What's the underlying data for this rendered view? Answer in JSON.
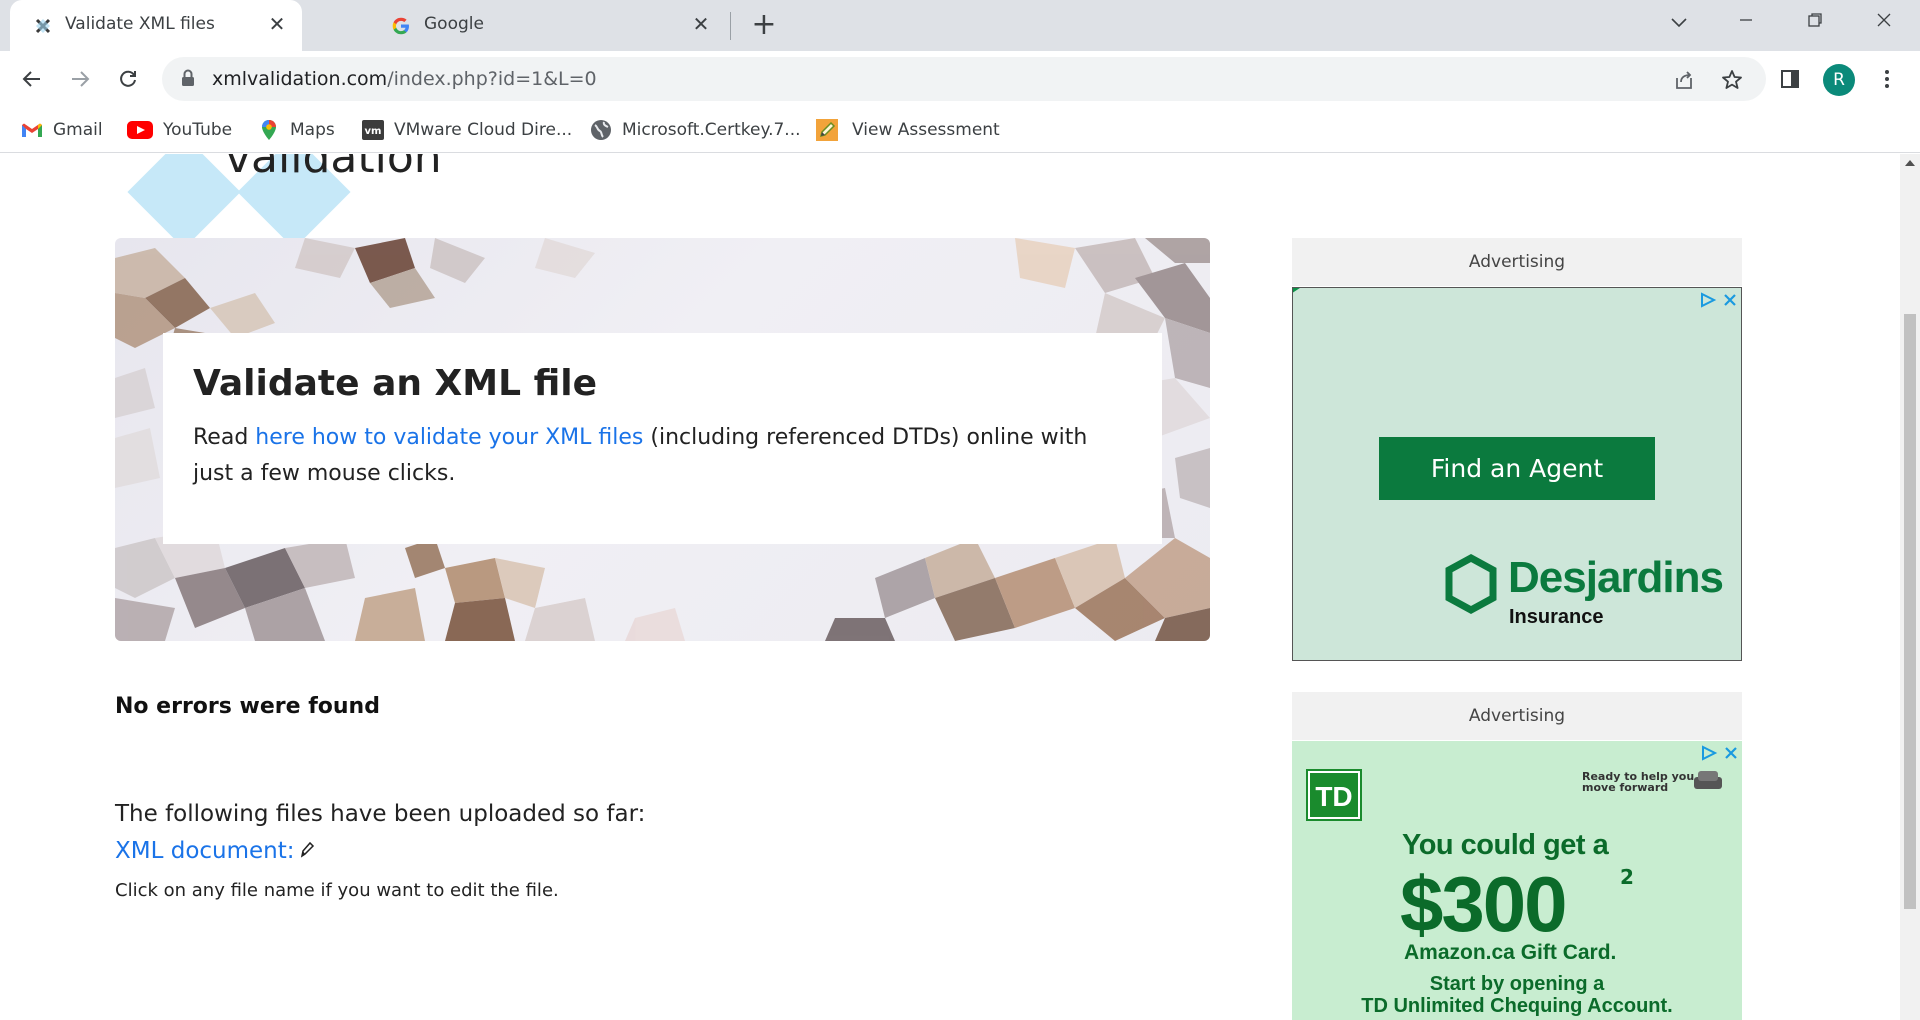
{
  "browser": {
    "tabs": [
      {
        "title": "Validate XML files",
        "active": true
      },
      {
        "title": "Google",
        "active": false
      }
    ],
    "url_domain": "xmlvalidation.com",
    "url_path": "/index.php?id=1&L=0",
    "profile_initial": "R",
    "bookmarks": [
      {
        "label": "Gmail",
        "icon": "gmail-icon"
      },
      {
        "label": "YouTube",
        "icon": "youtube-icon"
      },
      {
        "label": "Maps",
        "icon": "maps-icon"
      },
      {
        "label": "VMware Cloud Dire...",
        "icon": "vmware-icon"
      },
      {
        "label": "Microsoft.Certkey.7...",
        "icon": "globe-icon"
      },
      {
        "label": "View Assessment",
        "icon": "pencil-icon"
      }
    ]
  },
  "page": {
    "logo_text": "validation",
    "hero": {
      "heading": "Validate an XML file",
      "text_before": "Read ",
      "link_text": "here how to validate your XML files",
      "text_after": " (including referenced DTDs) online with just a few mouse clicks."
    },
    "result": "No errors were found",
    "uploaded_label": "The following files have been uploaded so far:",
    "file_link": "XML document:",
    "hint": "Click on any file name if you want to edit the file."
  },
  "ads": {
    "label": "Advertising",
    "ad1": {
      "button": "Find an Agent",
      "brand": "Desjardins",
      "sub": "Insurance",
      "colors": {
        "green": "#0b7a3e",
        "bg": "#cde6d9"
      }
    },
    "ad2": {
      "logo": "TD",
      "tagline_1": "Ready to help you",
      "tagline_2": "move forward",
      "line1": "You could get a",
      "amount": "$300",
      "superscript": "2",
      "gift": "Amazon.ca Gift Card.",
      "start_1": "Start by opening a",
      "start_2": "TD Unlimited Chequing Account."
    }
  }
}
